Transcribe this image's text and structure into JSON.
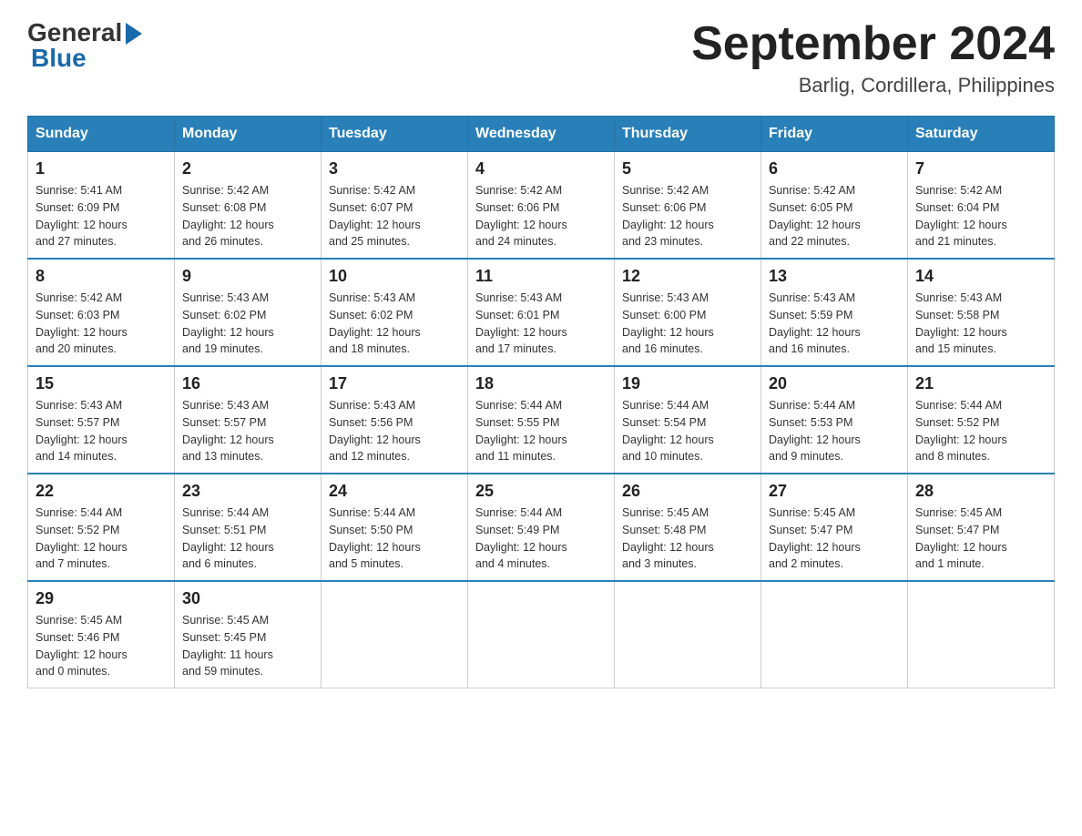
{
  "header": {
    "logo_general": "General",
    "logo_blue": "Blue",
    "month_title": "September 2024",
    "location": "Barlig, Cordillera, Philippines"
  },
  "weekdays": [
    "Sunday",
    "Monday",
    "Tuesday",
    "Wednesday",
    "Thursday",
    "Friday",
    "Saturday"
  ],
  "weeks": [
    [
      {
        "day": "1",
        "sunrise": "5:41 AM",
        "sunset": "6:09 PM",
        "daylight": "12 hours and 27 minutes."
      },
      {
        "day": "2",
        "sunrise": "5:42 AM",
        "sunset": "6:08 PM",
        "daylight": "12 hours and 26 minutes."
      },
      {
        "day": "3",
        "sunrise": "5:42 AM",
        "sunset": "6:07 PM",
        "daylight": "12 hours and 25 minutes."
      },
      {
        "day": "4",
        "sunrise": "5:42 AM",
        "sunset": "6:06 PM",
        "daylight": "12 hours and 24 minutes."
      },
      {
        "day": "5",
        "sunrise": "5:42 AM",
        "sunset": "6:06 PM",
        "daylight": "12 hours and 23 minutes."
      },
      {
        "day": "6",
        "sunrise": "5:42 AM",
        "sunset": "6:05 PM",
        "daylight": "12 hours and 22 minutes."
      },
      {
        "day": "7",
        "sunrise": "5:42 AM",
        "sunset": "6:04 PM",
        "daylight": "12 hours and 21 minutes."
      }
    ],
    [
      {
        "day": "8",
        "sunrise": "5:42 AM",
        "sunset": "6:03 PM",
        "daylight": "12 hours and 20 minutes."
      },
      {
        "day": "9",
        "sunrise": "5:43 AM",
        "sunset": "6:02 PM",
        "daylight": "12 hours and 19 minutes."
      },
      {
        "day": "10",
        "sunrise": "5:43 AM",
        "sunset": "6:02 PM",
        "daylight": "12 hours and 18 minutes."
      },
      {
        "day": "11",
        "sunrise": "5:43 AM",
        "sunset": "6:01 PM",
        "daylight": "12 hours and 17 minutes."
      },
      {
        "day": "12",
        "sunrise": "5:43 AM",
        "sunset": "6:00 PM",
        "daylight": "12 hours and 16 minutes."
      },
      {
        "day": "13",
        "sunrise": "5:43 AM",
        "sunset": "5:59 PM",
        "daylight": "12 hours and 16 minutes."
      },
      {
        "day": "14",
        "sunrise": "5:43 AM",
        "sunset": "5:58 PM",
        "daylight": "12 hours and 15 minutes."
      }
    ],
    [
      {
        "day": "15",
        "sunrise": "5:43 AM",
        "sunset": "5:57 PM",
        "daylight": "12 hours and 14 minutes."
      },
      {
        "day": "16",
        "sunrise": "5:43 AM",
        "sunset": "5:57 PM",
        "daylight": "12 hours and 13 minutes."
      },
      {
        "day": "17",
        "sunrise": "5:43 AM",
        "sunset": "5:56 PM",
        "daylight": "12 hours and 12 minutes."
      },
      {
        "day": "18",
        "sunrise": "5:44 AM",
        "sunset": "5:55 PM",
        "daylight": "12 hours and 11 minutes."
      },
      {
        "day": "19",
        "sunrise": "5:44 AM",
        "sunset": "5:54 PM",
        "daylight": "12 hours and 10 minutes."
      },
      {
        "day": "20",
        "sunrise": "5:44 AM",
        "sunset": "5:53 PM",
        "daylight": "12 hours and 9 minutes."
      },
      {
        "day": "21",
        "sunrise": "5:44 AM",
        "sunset": "5:52 PM",
        "daylight": "12 hours and 8 minutes."
      }
    ],
    [
      {
        "day": "22",
        "sunrise": "5:44 AM",
        "sunset": "5:52 PM",
        "daylight": "12 hours and 7 minutes."
      },
      {
        "day": "23",
        "sunrise": "5:44 AM",
        "sunset": "5:51 PM",
        "daylight": "12 hours and 6 minutes."
      },
      {
        "day": "24",
        "sunrise": "5:44 AM",
        "sunset": "5:50 PM",
        "daylight": "12 hours and 5 minutes."
      },
      {
        "day": "25",
        "sunrise": "5:44 AM",
        "sunset": "5:49 PM",
        "daylight": "12 hours and 4 minutes."
      },
      {
        "day": "26",
        "sunrise": "5:45 AM",
        "sunset": "5:48 PM",
        "daylight": "12 hours and 3 minutes."
      },
      {
        "day": "27",
        "sunrise": "5:45 AM",
        "sunset": "5:47 PM",
        "daylight": "12 hours and 2 minutes."
      },
      {
        "day": "28",
        "sunrise": "5:45 AM",
        "sunset": "5:47 PM",
        "daylight": "12 hours and 1 minute."
      }
    ],
    [
      {
        "day": "29",
        "sunrise": "5:45 AM",
        "sunset": "5:46 PM",
        "daylight": "12 hours and 0 minutes."
      },
      {
        "day": "30",
        "sunrise": "5:45 AM",
        "sunset": "5:45 PM",
        "daylight": "11 hours and 59 minutes."
      },
      null,
      null,
      null,
      null,
      null
    ]
  ],
  "labels": {
    "sunrise": "Sunrise:",
    "sunset": "Sunset:",
    "daylight": "Daylight:"
  }
}
